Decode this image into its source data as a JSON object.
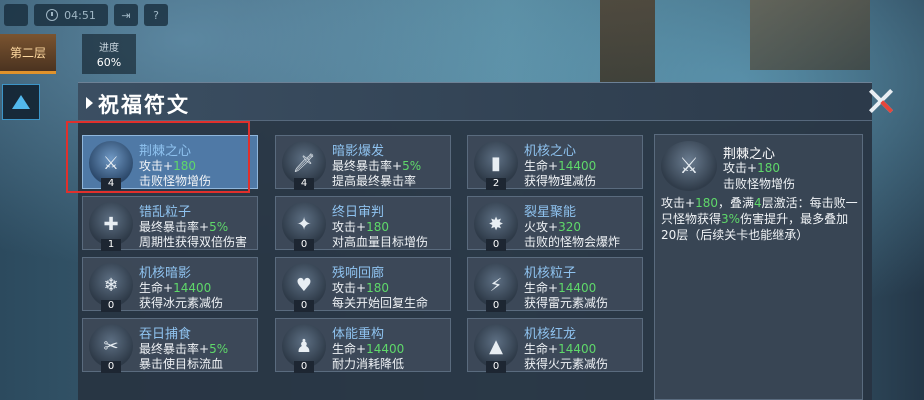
{
  "hud": {
    "time": "04:51",
    "floor_label": "第二层",
    "progress_label": "进度",
    "progress_value": "60%"
  },
  "panel": {
    "title": "祝福符文"
  },
  "runes": [
    {
      "name": "荆棘之心",
      "line1_prefix": "攻击+",
      "line1_value": "180",
      "line1_suffix": "",
      "line2": "击败怪物增伤",
      "count": "4",
      "icon": "blades-icon",
      "selected": true
    },
    {
      "name": "暗影爆发",
      "line1_prefix": "最终暴击率+",
      "line1_value": "5%",
      "line1_suffix": "",
      "line2": "提高最终暴击率",
      "count": "4",
      "icon": "dagger-icon"
    },
    {
      "name": "机核之心",
      "line1_prefix": "生命+",
      "line1_value": "14400",
      "line1_suffix": "",
      "line2": "获得物理减伤",
      "count": "2",
      "icon": "core-icon"
    },
    {
      "name": "错乱粒子",
      "line1_prefix": "最终暴击率+",
      "line1_value": "5%",
      "line1_suffix": "",
      "line2": "周期性获得双倍伤害",
      "count": "1",
      "icon": "particle-icon"
    },
    {
      "name": "终日审判",
      "line1_prefix": "攻击+",
      "line1_value": "180",
      "line1_suffix": "",
      "line2": "对高血量目标增伤",
      "count": "0",
      "icon": "star-icon"
    },
    {
      "name": "裂星聚能",
      "line1_prefix": "火攻+",
      "line1_value": "320",
      "line1_suffix": "",
      "line2": "击败的怪物会爆炸",
      "count": "0",
      "icon": "burst-icon"
    },
    {
      "name": "机核暗影",
      "line1_prefix": "生命+",
      "line1_value": "14400",
      "line1_suffix": "",
      "line2": "获得冰元素减伤",
      "count": "0",
      "icon": "snowflake-icon"
    },
    {
      "name": "残响回廊",
      "line1_prefix": "攻击+",
      "line1_value": "180",
      "line1_suffix": "",
      "line2": "每关开始回复生命",
      "count": "0",
      "icon": "heal-icon"
    },
    {
      "name": "机核粒子",
      "line1_prefix": "生命+",
      "line1_value": "14400",
      "line1_suffix": "",
      "line2": "获得雷元素减伤",
      "count": "0",
      "icon": "lightning-icon"
    },
    {
      "name": "吞日捕食",
      "line1_prefix": "最终暴击率+",
      "line1_value": "5%",
      "line1_suffix": "",
      "line2": "暴击使目标流血",
      "count": "0",
      "icon": "bleed-icon"
    },
    {
      "name": "体能重构",
      "line1_prefix": "生命+",
      "line1_value": "14400",
      "line1_suffix": "",
      "line2": "耐力消耗降低",
      "count": "0",
      "icon": "figure-icon"
    },
    {
      "name": "机核红龙",
      "line1_prefix": "生命+",
      "line1_value": "14400",
      "line1_suffix": "",
      "line2": "获得火元素减伤",
      "count": "0",
      "icon": "flame-icon"
    }
  ],
  "detail": {
    "name": "荆棘之心",
    "line1_prefix": "攻击+",
    "line1_value": "180",
    "line2": "击败怪物增伤",
    "desc_a": "攻击+",
    "desc_b": "180",
    "desc_c": "，叠满",
    "desc_d": "4",
    "desc_e": "层激活：每击败一只怪物获得",
    "desc_f": "3%",
    "desc_g": "伤害提升，最多叠加20层（后续关卡也能继承）"
  },
  "colors": {
    "accent_blue": "#8fc3f0",
    "value_green": "#5fd86a",
    "selected_card": "#4f79a6",
    "highlight_frame": "#e0302c"
  }
}
